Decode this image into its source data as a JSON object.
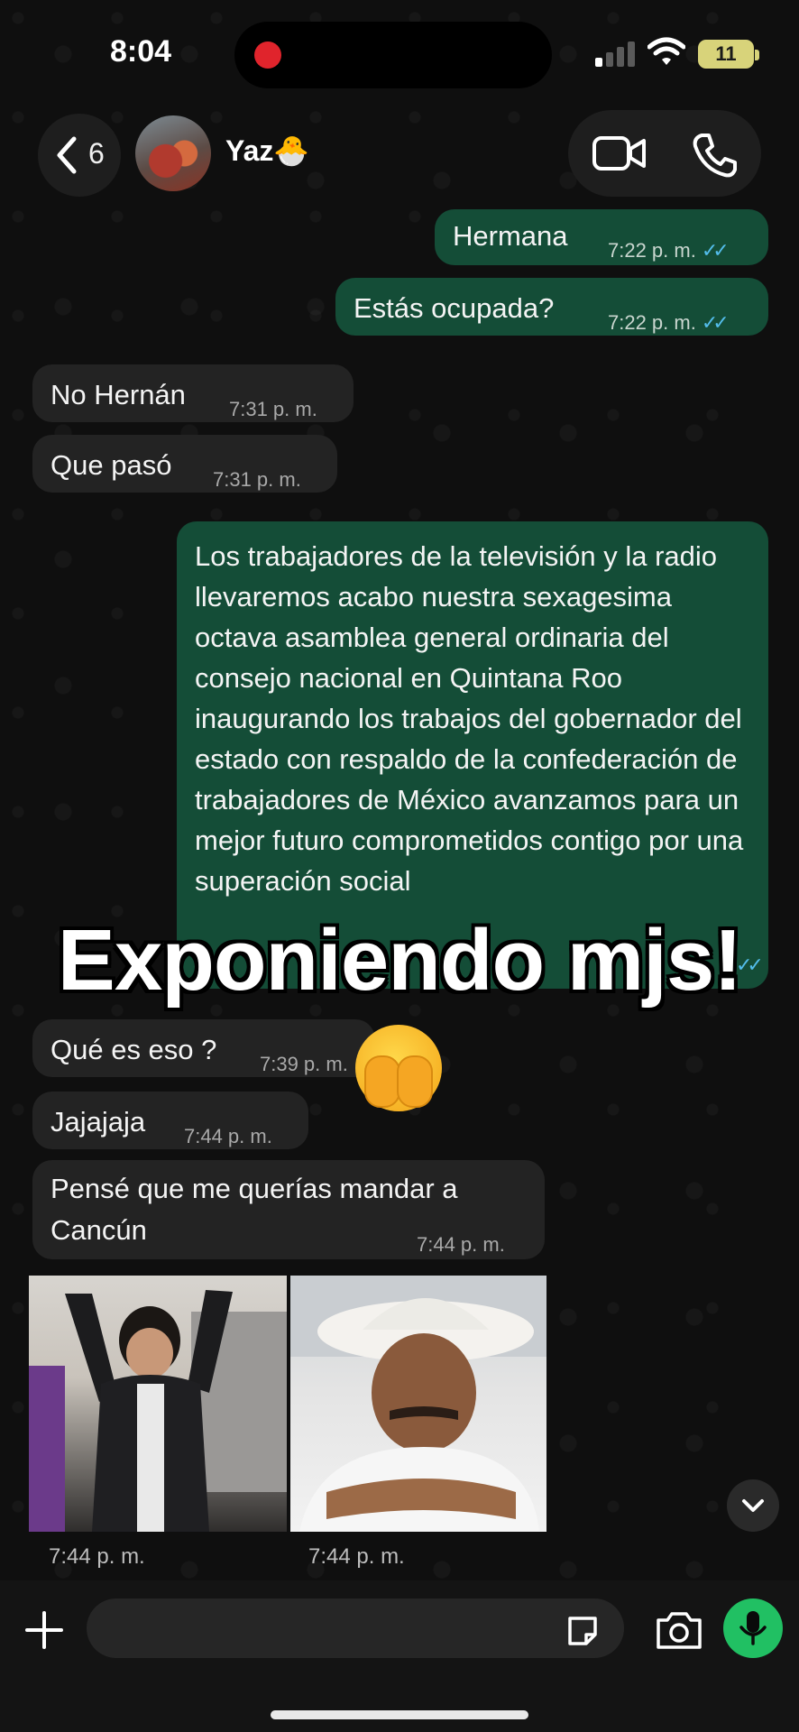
{
  "status_bar": {
    "time": "8:04",
    "battery": "11"
  },
  "header": {
    "back_count": "6",
    "contact_name": "Yaz🐣"
  },
  "messages": {
    "m1": {
      "text": "Hermana",
      "time": "7:22 p. m."
    },
    "m2": {
      "text": "Estás ocupada?",
      "time": "7:22 p. m."
    },
    "m3": {
      "text": "No Hernán",
      "time": "7:31 p. m."
    },
    "m4": {
      "text": "Que pasó",
      "time": "7:31 p. m."
    },
    "m5": {
      "text": "Los trabajadores de la televisión y la radio llevaremos acabo nuestra sexagesima octava asamblea general ordinaria del consejo nacional en Quintana Roo inaugurando los trabajos del gobernador del estado con respaldo de la confederación de trabajadores de México avanzamos para un mejor futuro comprometidos contigo por una superación social"
    },
    "m6": {
      "text": "Qué es eso ?",
      "time": "7:39 p. m."
    },
    "m7": {
      "text": "Jajajaja",
      "time": "7:44 p. m."
    },
    "m8": {
      "line1": "Pensé que me querías mandar a",
      "line2": "Cancún",
      "time": "7:44 p. m."
    },
    "photo1": {
      "time": "7:44 p. m."
    },
    "photo2": {
      "time": "7:44 p. m."
    }
  },
  "overlay": {
    "caption": "Exponiendo mjs!"
  },
  "colors": {
    "outgoing": "#144d37",
    "incoming": "#232323",
    "mic": "#21c063",
    "ticks": "#53bdeb"
  }
}
